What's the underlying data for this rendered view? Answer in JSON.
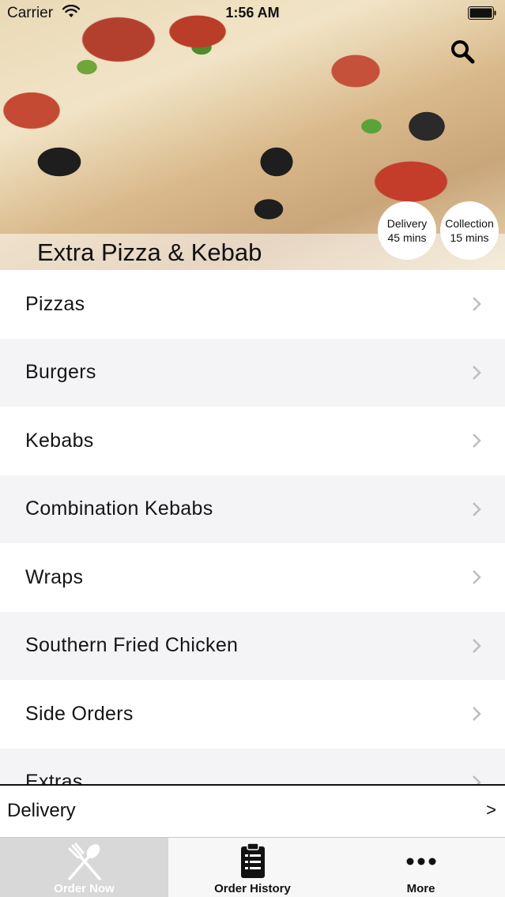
{
  "status_bar": {
    "carrier": "Carrier",
    "time": "1:56 AM"
  },
  "header": {
    "restaurant_name": "Extra Pizza & Kebab",
    "search_icon": "search-icon",
    "delivery_badge": {
      "label": "Delivery",
      "time": "45 mins"
    },
    "collection_badge": {
      "label": "Collection",
      "time": "15 mins"
    }
  },
  "categories": [
    {
      "label": "Pizzas"
    },
    {
      "label": "Burgers"
    },
    {
      "label": "Kebabs"
    },
    {
      "label": "Combination Kebabs"
    },
    {
      "label": "Wraps"
    },
    {
      "label": "Southern Fried Chicken"
    },
    {
      "label": "Side Orders"
    },
    {
      "label": "Extras"
    }
  ],
  "order_type_bar": {
    "label": "Delivery",
    "arrow": ">"
  },
  "tab_bar": {
    "tabs": [
      {
        "label": "Order Now",
        "icon": "fork-spoon-icon",
        "selected": true
      },
      {
        "label": "Order History",
        "icon": "clipboard-list-icon",
        "selected": false
      },
      {
        "label": "More",
        "icon": "more-dots-icon",
        "selected": false
      }
    ]
  },
  "colors": {
    "list_row_alt": "#f4f4f6",
    "tab_selected_bg": "#d8d8d8",
    "text": "#111111"
  }
}
